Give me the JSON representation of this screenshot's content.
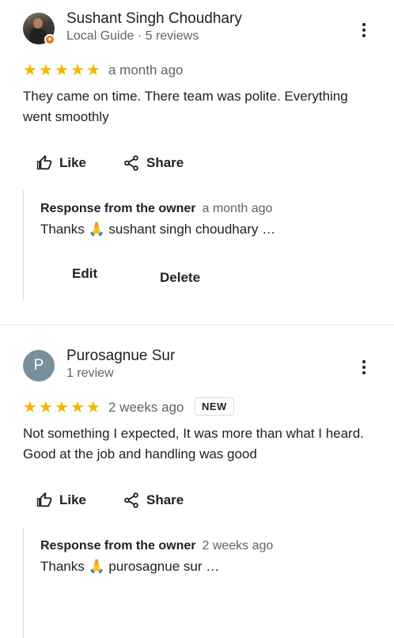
{
  "reviews": [
    {
      "name": "Sushant Singh Choudhary",
      "meta": "Local Guide · 5 reviews",
      "avatar_type": "photo",
      "local_guide_badge_icon": "star-badge-icon",
      "rating": 5,
      "date": "a month ago",
      "text": "They came on time. There team was polite. Everything went smoothly",
      "like_label": "Like",
      "share_label": "Share",
      "owner_response": {
        "label": "Response from the owner",
        "date": "a month ago",
        "text": "Thanks 🙏 sushant singh choudhary  …"
      },
      "edit_label": "Edit",
      "delete_label": "Delete"
    },
    {
      "name": "Purosagnue Sur",
      "meta": "1 review",
      "avatar_letter": "P",
      "rating": 5,
      "date": "2 weeks ago",
      "new_badge": "NEW",
      "text": "Not something I expected, It was more than what I heard. Good at the job and handling was good",
      "like_label": "Like",
      "share_label": "Share",
      "owner_response": {
        "label": "Response from the owner",
        "date": "2 weeks ago",
        "text": "Thanks 🙏 purosagnue sur …"
      }
    }
  ],
  "colors": {
    "star": "#f6b400",
    "avatar_letter_bg": "#78909c",
    "local_guide_badge": "#e8710a",
    "muted_text": "#5f6368",
    "divider": "#e3e3e3"
  }
}
